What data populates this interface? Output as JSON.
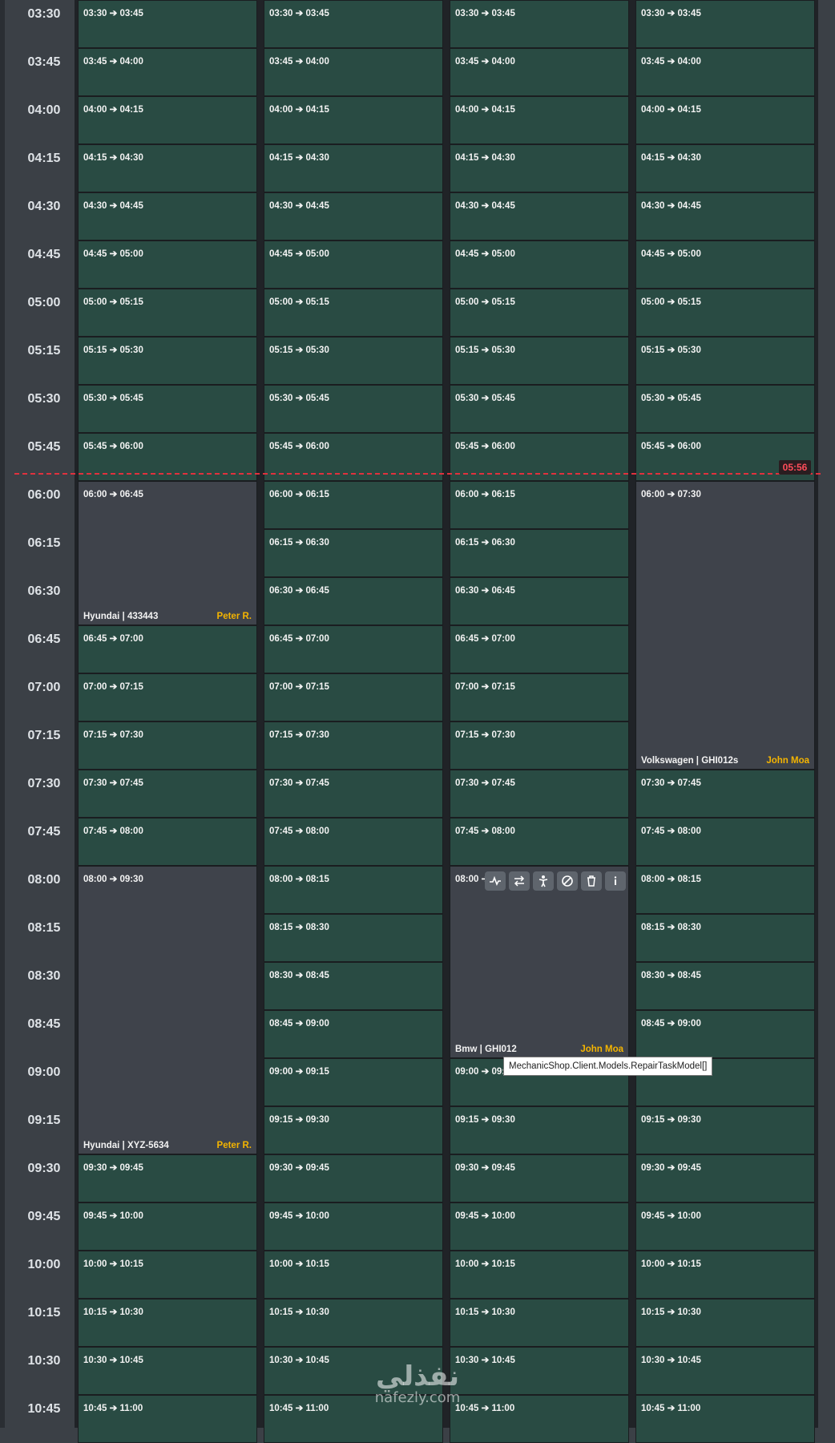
{
  "now_badge": "05:56",
  "time_labels": [
    "03:30",
    "03:45",
    "04:00",
    "04:15",
    "04:30",
    "04:45",
    "05:00",
    "05:15",
    "05:30",
    "05:45",
    "06:00",
    "06:15",
    "06:30",
    "06:45",
    "07:00",
    "07:15",
    "07:30",
    "07:45",
    "08:00",
    "08:15",
    "08:30",
    "08:45",
    "09:00",
    "09:15",
    "09:30",
    "09:45",
    "10:00",
    "10:15",
    "10:30",
    "10:45"
  ],
  "columns": [
    {
      "name": "col-1",
      "slots": [
        {
          "label": "03:30 ➔ 03:45"
        },
        {
          "label": "03:45 ➔ 04:00"
        },
        {
          "label": "04:00 ➔ 04:15"
        },
        {
          "label": "04:15 ➔ 04:30"
        },
        {
          "label": "04:30 ➔ 04:45"
        },
        {
          "label": "04:45 ➔ 05:00"
        },
        {
          "label": "05:00 ➔ 05:15"
        },
        {
          "label": "05:15 ➔ 05:30"
        },
        {
          "label": "05:30 ➔ 05:45"
        },
        {
          "label": "05:45 ➔ 06:00"
        },
        {
          "label": "06:00 ➔ 06:45",
          "span": 3,
          "booked": true,
          "vehicle": "Hyundai | 433443",
          "mechanic": "Peter R."
        },
        {
          "label": "06:45 ➔ 07:00"
        },
        {
          "label": "07:00 ➔ 07:15"
        },
        {
          "label": "07:15 ➔ 07:30"
        },
        {
          "label": "07:30 ➔ 07:45"
        },
        {
          "label": "07:45 ➔ 08:00"
        },
        {
          "label": "08:00 ➔ 09:30",
          "span": 6,
          "booked": true,
          "vehicle": "Hyundai | XYZ-5634",
          "mechanic": "Peter R."
        },
        {
          "label": "09:30 ➔ 09:45"
        },
        {
          "label": "09:45 ➔ 10:00"
        },
        {
          "label": "10:00 ➔ 10:15"
        },
        {
          "label": "10:15 ➔ 10:30"
        },
        {
          "label": "10:30 ➔ 10:45"
        },
        {
          "label": "10:45 ➔ 11:00"
        }
      ]
    },
    {
      "name": "col-2",
      "slots": [
        {
          "label": "03:30 ➔ 03:45"
        },
        {
          "label": "03:45 ➔ 04:00"
        },
        {
          "label": "04:00 ➔ 04:15"
        },
        {
          "label": "04:15 ➔ 04:30"
        },
        {
          "label": "04:30 ➔ 04:45"
        },
        {
          "label": "04:45 ➔ 05:00"
        },
        {
          "label": "05:00 ➔ 05:15"
        },
        {
          "label": "05:15 ➔ 05:30"
        },
        {
          "label": "05:30 ➔ 05:45"
        },
        {
          "label": "05:45 ➔ 06:00"
        },
        {
          "label": "06:00 ➔ 06:15"
        },
        {
          "label": "06:15 ➔ 06:30"
        },
        {
          "label": "06:30 ➔ 06:45"
        },
        {
          "label": "06:45 ➔ 07:00"
        },
        {
          "label": "07:00 ➔ 07:15"
        },
        {
          "label": "07:15 ➔ 07:30"
        },
        {
          "label": "07:30 ➔ 07:45"
        },
        {
          "label": "07:45 ➔ 08:00"
        },
        {
          "label": "08:00 ➔ 08:15"
        },
        {
          "label": "08:15 ➔ 08:30"
        },
        {
          "label": "08:30 ➔ 08:45"
        },
        {
          "label": "08:45 ➔ 09:00"
        },
        {
          "label": "09:00 ➔ 09:15"
        },
        {
          "label": "09:15 ➔ 09:30"
        },
        {
          "label": "09:30 ➔ 09:45"
        },
        {
          "label": "09:45 ➔ 10:00"
        },
        {
          "label": "10:00 ➔ 10:15"
        },
        {
          "label": "10:15 ➔ 10:30"
        },
        {
          "label": "10:30 ➔ 10:45"
        },
        {
          "label": "10:45 ➔ 11:00"
        }
      ]
    },
    {
      "name": "col-3",
      "slots": [
        {
          "label": "03:30 ➔ 03:45"
        },
        {
          "label": "03:45 ➔ 04:00"
        },
        {
          "label": "04:00 ➔ 04:15"
        },
        {
          "label": "04:15 ➔ 04:30"
        },
        {
          "label": "04:30 ➔ 04:45"
        },
        {
          "label": "04:45 ➔ 05:00"
        },
        {
          "label": "05:00 ➔ 05:15"
        },
        {
          "label": "05:15 ➔ 05:30"
        },
        {
          "label": "05:30 ➔ 05:45"
        },
        {
          "label": "05:45 ➔ 06:00"
        },
        {
          "label": "06:00 ➔ 06:15"
        },
        {
          "label": "06:15 ➔ 06:30"
        },
        {
          "label": "06:30 ➔ 06:45"
        },
        {
          "label": "06:45 ➔ 07:00"
        },
        {
          "label": "07:00 ➔ 07:15"
        },
        {
          "label": "07:15 ➔ 07:30"
        },
        {
          "label": "07:30 ➔ 07:45"
        },
        {
          "label": "07:45 ➔ 08:00"
        },
        {
          "label": "08:00 ➔",
          "span": 4,
          "booked": true,
          "vehicle": "Bmw | GHI012",
          "mechanic": "John Moa"
        },
        {
          "label": "09:00 ➔ 09:15"
        },
        {
          "label": "09:15 ➔ 09:30"
        },
        {
          "label": "09:30 ➔ 09:45"
        },
        {
          "label": "09:45 ➔ 10:00"
        },
        {
          "label": "10:00 ➔ 10:15"
        },
        {
          "label": "10:15 ➔ 10:30"
        },
        {
          "label": "10:30 ➔ 10:45"
        },
        {
          "label": "10:45 ➔ 11:00"
        }
      ]
    },
    {
      "name": "col-4",
      "slots": [
        {
          "label": "03:30 ➔ 03:45"
        },
        {
          "label": "03:45 ➔ 04:00"
        },
        {
          "label": "04:00 ➔ 04:15"
        },
        {
          "label": "04:15 ➔ 04:30"
        },
        {
          "label": "04:30 ➔ 04:45"
        },
        {
          "label": "04:45 ➔ 05:00"
        },
        {
          "label": "05:00 ➔ 05:15"
        },
        {
          "label": "05:15 ➔ 05:30"
        },
        {
          "label": "05:30 ➔ 05:45"
        },
        {
          "label": "05:45 ➔ 06:00"
        },
        {
          "label": "06:00 ➔ 07:30",
          "span": 6,
          "booked": true,
          "vehicle": "Volkswagen | GHI012s",
          "mechanic": "John Moa"
        },
        {
          "label": "07:30 ➔ 07:45"
        },
        {
          "label": "07:45 ➔ 08:00"
        },
        {
          "label": "08:00 ➔ 08:15"
        },
        {
          "label": "08:15 ➔ 08:30"
        },
        {
          "label": "08:30 ➔ 08:45"
        },
        {
          "label": "08:45 ➔ 09:00"
        },
        {
          "label": "09:00 ➔ 09:15"
        },
        {
          "label": "09:15 ➔ 09:30"
        },
        {
          "label": "09:30 ➔ 09:45"
        },
        {
          "label": "09:45 ➔ 10:00"
        },
        {
          "label": "10:00 ➔ 10:15"
        },
        {
          "label": "10:15 ➔ 10:30"
        },
        {
          "label": "10:30 ➔ 10:45"
        },
        {
          "label": "10:45 ➔ 11:00"
        }
      ]
    }
  ],
  "task_toolbar": {
    "buttons": [
      {
        "name": "activity-icon-button",
        "icon": "activity-icon"
      },
      {
        "name": "swap-icon-button",
        "icon": "swap-arrows-icon"
      },
      {
        "name": "assign-mechanic-button",
        "icon": "person-icon"
      },
      {
        "name": "cancel-task-button",
        "icon": "circle-slash-icon"
      },
      {
        "name": "delete-task-button",
        "icon": "trash-icon"
      },
      {
        "name": "info-button",
        "icon": "info-icon"
      }
    ]
  },
  "tooltip": "MechanicShop.Client.Models.RepairTaskModel[]",
  "watermark": {
    "arabic": "نفذلي",
    "latin": "nafezly.com"
  },
  "colors": {
    "free_slot": "#294b43",
    "booked_slot": "#3f434b",
    "mechanic_name": "#f4b400",
    "now_line": "#e0313d"
  }
}
